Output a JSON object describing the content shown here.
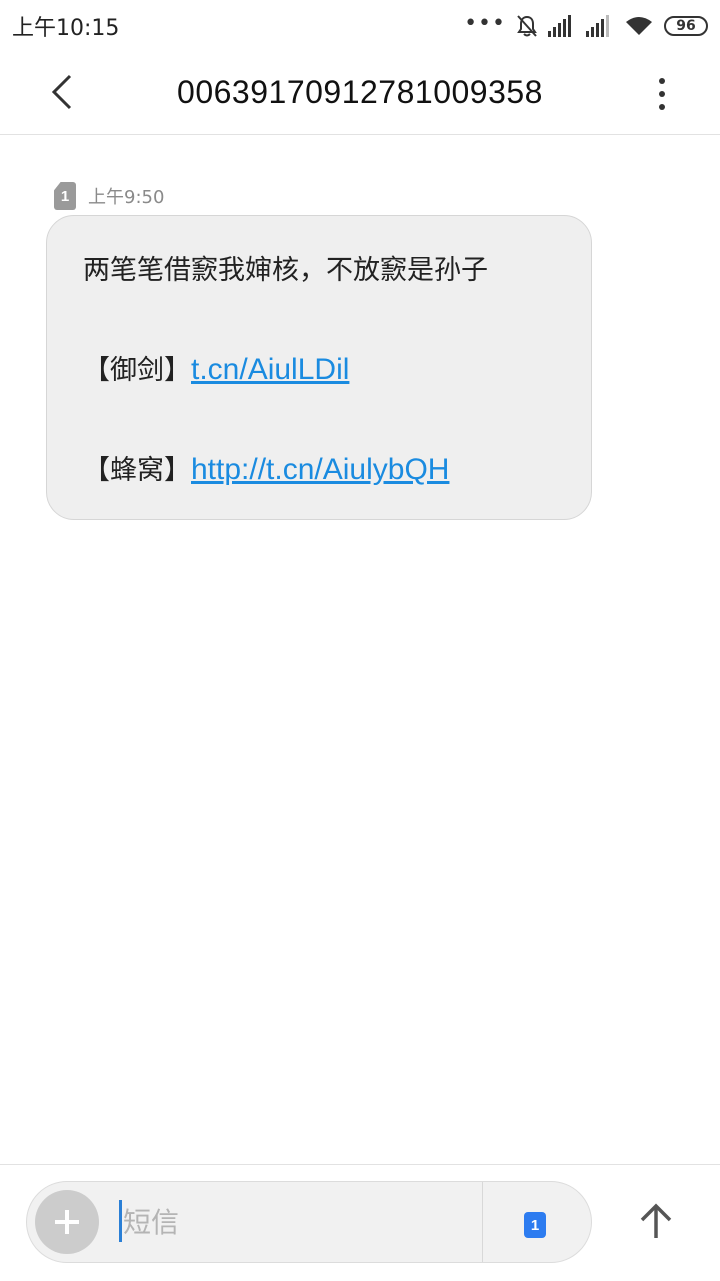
{
  "status_bar": {
    "time": "上午10:15",
    "battery": "96",
    "icons": [
      "more-dots-icon",
      "mute-bell-icon",
      "signal-icon",
      "signal-icon",
      "wifi-icon",
      "battery-icon"
    ]
  },
  "header": {
    "title": "00639170912781009358",
    "back_icon": "chevron-left-icon",
    "menu_icon": "more-vertical-icon"
  },
  "message": {
    "sim_label": "1",
    "time": "上午9:50",
    "line1": "两笔笔借窾我婶核，不放窾是孙子",
    "line2_prefix": "【御剑】",
    "line2_link": "t.cn/AiulLDil",
    "line3_prefix": "【蜂窝】",
    "line3_link": "http://t.cn/AiulybQH"
  },
  "composer": {
    "placeholder": "短信",
    "sim_label": "1",
    "add_icon": "plus-icon",
    "send_icon": "arrow-up-icon"
  },
  "colors": {
    "link": "#1a8be0",
    "sim_blue": "#2d7cf0",
    "bubble": "#efefef"
  }
}
